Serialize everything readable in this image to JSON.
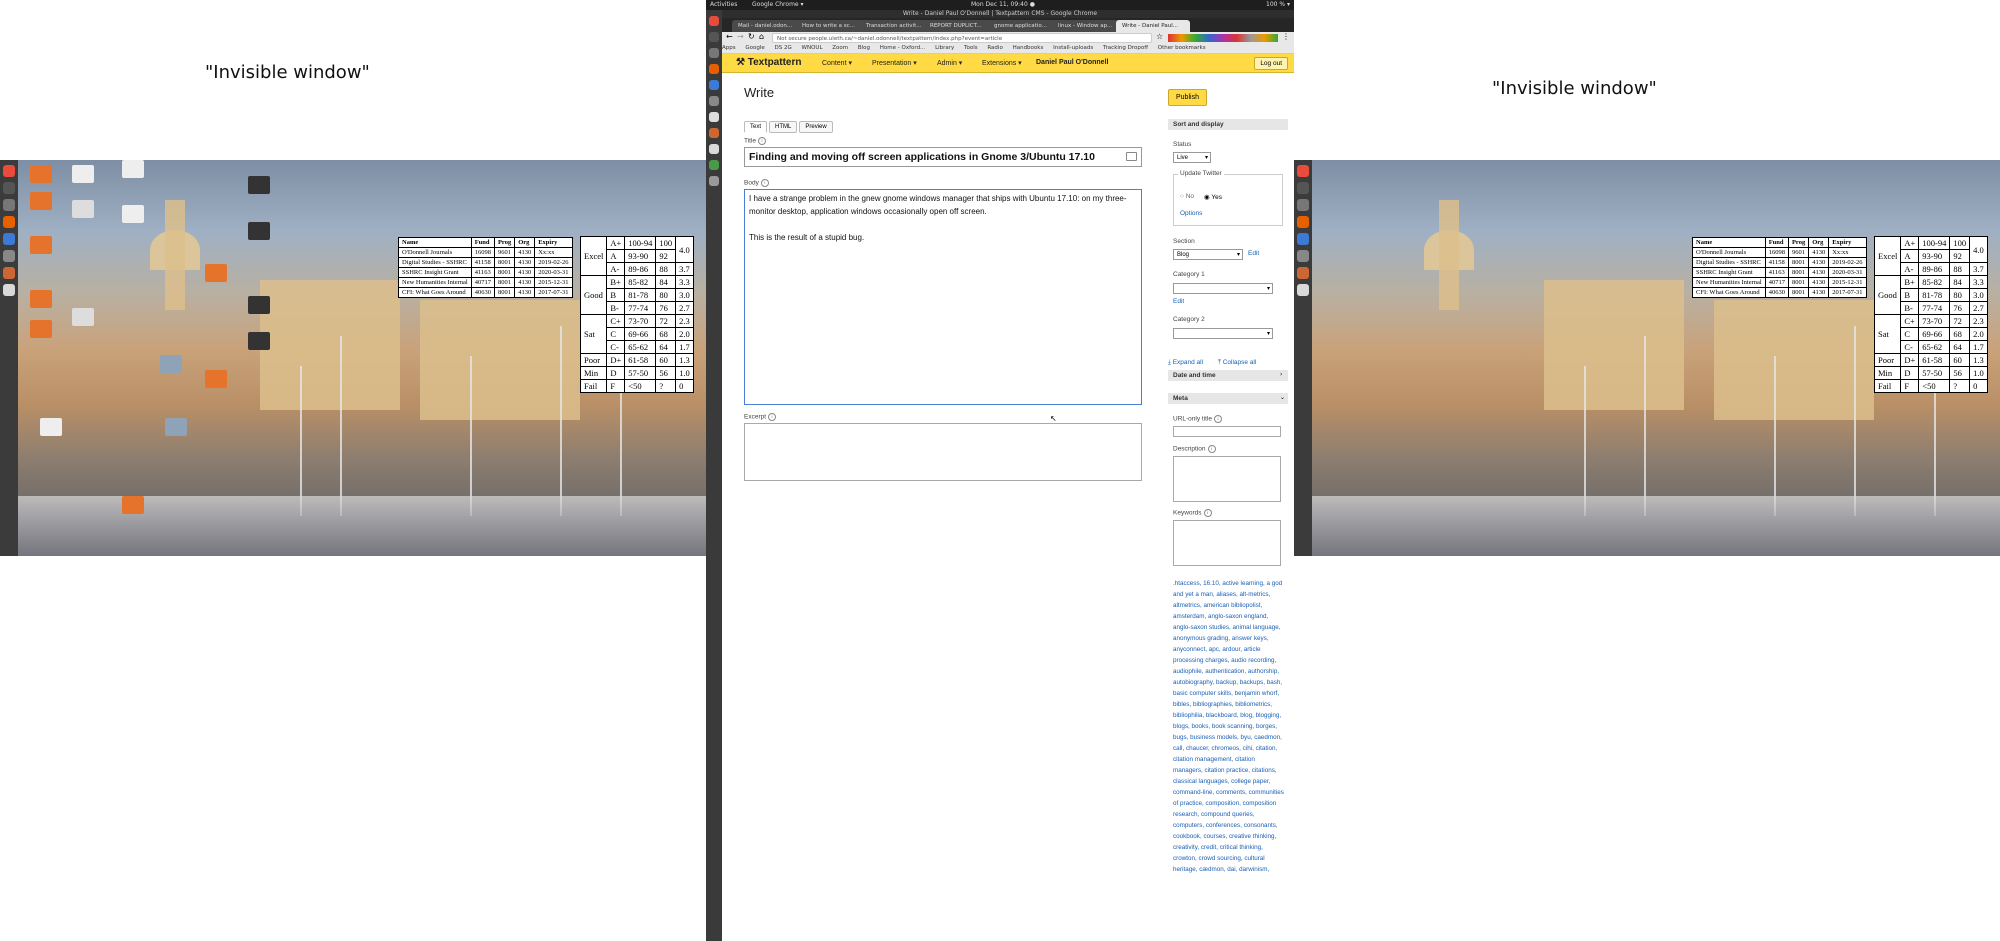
{
  "monitors": {
    "left_label": "\"Invisible window\"",
    "right_label": "\"Invisible window\""
  },
  "grade_table": {
    "rows": [
      {
        "group": "Excel",
        "letter": "A+",
        "range": "100-94",
        "pct": "100",
        "gpa": "4.0"
      },
      {
        "group": "",
        "letter": "A",
        "range": "93-90",
        "pct": "92",
        "gpa": ""
      },
      {
        "group": "",
        "letter": "A-",
        "range": "89-86",
        "pct": "88",
        "gpa": "3.7"
      },
      {
        "group": "Good",
        "letter": "B+",
        "range": "85-82",
        "pct": "84",
        "gpa": "3.3"
      },
      {
        "group": "",
        "letter": "B",
        "range": "81-78",
        "pct": "80",
        "gpa": "3.0"
      },
      {
        "group": "",
        "letter": "B-",
        "range": "77-74",
        "pct": "76",
        "gpa": "2.7"
      },
      {
        "group": "Sat",
        "letter": "C+",
        "range": "73-70",
        "pct": "72",
        "gpa": "2.3"
      },
      {
        "group": "",
        "letter": "C",
        "range": "69-66",
        "pct": "68",
        "gpa": "2.0"
      },
      {
        "group": "",
        "letter": "C-",
        "range": "65-62",
        "pct": "64",
        "gpa": "1.7"
      },
      {
        "group": "Poor",
        "letter": "D+",
        "range": "61-58",
        "pct": "60",
        "gpa": "1.3"
      },
      {
        "group": "Min",
        "letter": "D",
        "range": "57-50",
        "pct": "56",
        "gpa": "1.0"
      },
      {
        "group": "Fail",
        "letter": "F",
        "range": "<50",
        "pct": "?",
        "gpa": "0"
      }
    ]
  },
  "journal_table": {
    "headers": [
      "Name",
      "Fund",
      "Prog",
      "Org",
      "Expiry"
    ],
    "rows": [
      [
        "O'Donnell Journals",
        "16098",
        "9601",
        "4130",
        "Xx:xx"
      ],
      [
        "Digital Studies - SSHRC",
        "41158",
        "8001",
        "4130",
        "2019-02-26"
      ],
      [
        "SSHRC Insight Grant",
        "41163",
        "8001",
        "4130",
        "2020-03-31"
      ],
      [
        "New Humanities Internal",
        "40717",
        "8001",
        "4130",
        "2015-12-31"
      ],
      [
        "CFI: What Goes Around",
        "40630",
        "8001",
        "4130",
        "2017-07-31"
      ]
    ]
  },
  "system": {
    "activities": "Activities",
    "app": "Google Chrome ▾",
    "clock": "Mon Dec 11, 09:40 ●",
    "window_title": "Write - Daniel Paul O'Donnell | Textpattern CMS - Google Chrome",
    "battery": "100 % ▾",
    "user": "Daniel"
  },
  "browser": {
    "tabs": [
      "Mail - daniel.odon...",
      "How to write a sc...",
      "Transaction activit...",
      "REPORT DUPLICT...",
      "gnome applicatio...",
      "linux - Window ap...",
      "Write - Daniel Paul..."
    ],
    "url": "Not secure  people.uleth.ca/~daniel.odonnell/textpattern/index.php?event=article",
    "bookmarks": [
      "Apps",
      "Google",
      "DS 2G",
      "WNOUL",
      "Zoom",
      "Blog",
      "Home - Oxford...",
      "Library",
      "Tools",
      "Radio",
      "Handbooks",
      "Install-uploads",
      "Tracking Dropoff",
      "Other bookmarks"
    ]
  },
  "txp": {
    "logo": "Textpattern",
    "menu": [
      "Content ▾",
      "Presentation ▾",
      "Admin ▾",
      "Extensions ▾"
    ],
    "user": "Daniel Paul O'Donnell",
    "logout": "Log out",
    "page_title": "Write",
    "tabs": [
      "Text",
      "HTML",
      "Preview"
    ],
    "title_label": "Title",
    "title_value": "Finding and moving off screen applications in Gnome 3/Ubuntu 17.10",
    "body_label": "Body",
    "body_p1": "I have a strange problem in the gnew gnome windows manager that ships with Ubuntu 17.10: on my three-monitor desktop, application windows occasionally open off screen.",
    "body_p2": "This is the result of a stupid bug.",
    "excerpt_label": "Excerpt",
    "publish": "Publish",
    "sort_display": "Sort and display",
    "status_label": "Status",
    "status_value": "Live",
    "update_twitter": "Update Twitter",
    "no": "No",
    "yes": "Yes",
    "options": "Options",
    "section_label": "Section",
    "section_value": "Blog",
    "edit": "Edit",
    "category1": "Category 1",
    "category2": "Category 2",
    "expand_all": "Expand all",
    "collapse_all": "Collapse all",
    "date_time": "Date and time",
    "meta": "Meta",
    "url_only_title": "URL-only title",
    "description": "Description",
    "keywords": "Keywords",
    "tags": ".htaccess, 16.10, active learning, a god and yet a man, aliases, alt-metrics, altmetrics, american bibliopolist, amsterdam, anglo-saxon england, anglo-saxon studies, animal language, anonymous grading, answer keys, anyconnect, apc, ardour, article processing charges, audio recording, audiophile, authentication, authorship, autobiography, backup, backups, bash, basic computer skills, benjamin whorf, bibles, bibliographies, bibliometrics, bibliophilia, blackboard, blog, blogging, blogs, books, book scanning, borges, bugs, business models, byu, caedmon, call, chaucer, chromeos, cihi, citation, citation management, citation managers, citation practice, citations, classical languages, college paper, command-line, comments, communities of practice, composition, composition research, compound queries, computers, conferences, consonants, cookbook, courses, creative thinking, creativity, credit, critical thinking, crowton, crowd sourcing, cultural heritage, cædmon, dai, darwinism,"
  },
  "colors": {
    "txp_yellow": "#ffda44",
    "link_blue": "#1a5fb4",
    "focus_blue": "#4a7fd3"
  }
}
